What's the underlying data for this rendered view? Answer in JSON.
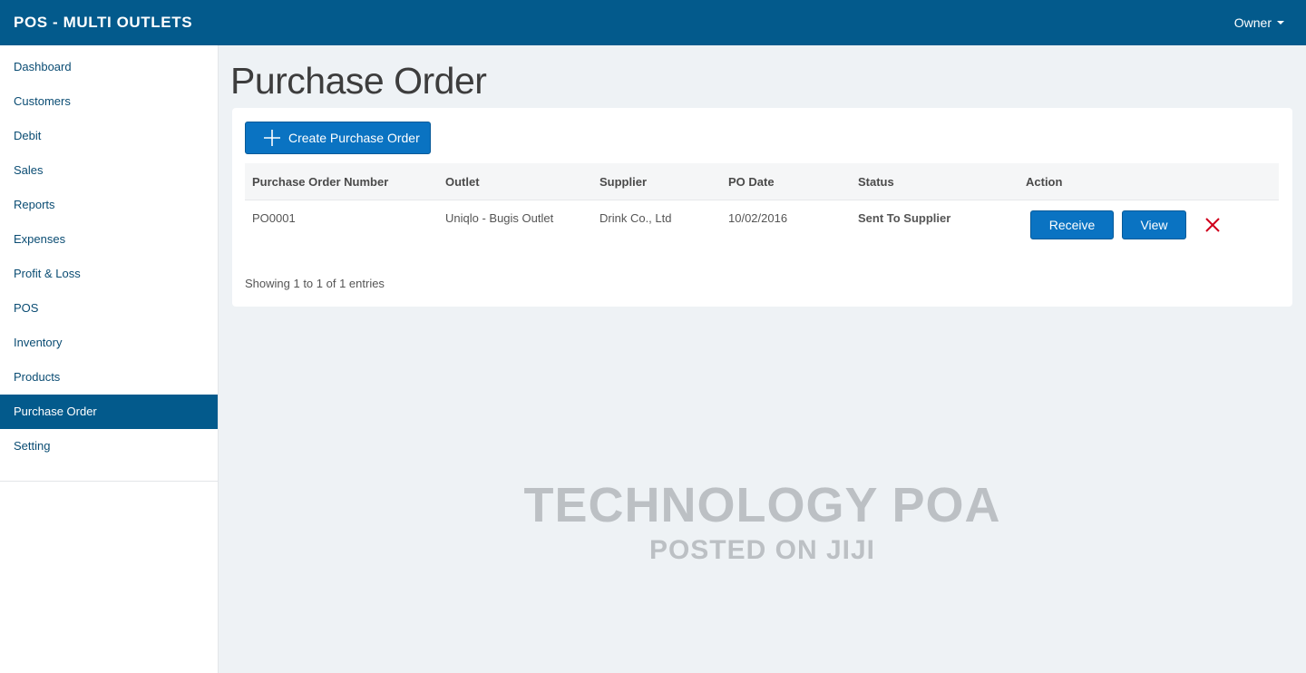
{
  "header": {
    "app_title": "POS - MULTI OUTLETS",
    "user_label": "Owner"
  },
  "sidebar": {
    "items": [
      {
        "label": "Dashboard"
      },
      {
        "label": "Customers"
      },
      {
        "label": "Debit"
      },
      {
        "label": "Sales"
      },
      {
        "label": "Reports"
      },
      {
        "label": "Expenses"
      },
      {
        "label": "Profit & Loss"
      },
      {
        "label": "POS"
      },
      {
        "label": "Inventory"
      },
      {
        "label": "Products"
      },
      {
        "label": "Purchase Order",
        "active": true
      },
      {
        "label": "Setting"
      }
    ]
  },
  "main": {
    "title": "Purchase Order",
    "create_label": "Create Purchase Order",
    "table": {
      "headers": [
        "Purchase Order Number",
        "Outlet",
        "Supplier",
        "PO Date",
        "Status",
        "Action"
      ],
      "rows": [
        {
          "po_number": "PO0001",
          "outlet": "Uniqlo - Bugis Outlet",
          "supplier": "Drink Co., Ltd",
          "po_date": "10/02/2016",
          "status": "Sent To Supplier",
          "receive_label": "Receive",
          "view_label": "View"
        }
      ]
    },
    "info": "Showing 1 to 1 of 1 entries"
  },
  "watermark": {
    "line1": "TECHNOLOGY POA",
    "line2": "POSTED ON JIJI"
  },
  "colors": {
    "brand": "#035a8c",
    "button": "#0a73c2",
    "delete": "#d0021b"
  },
  "icons": {
    "create": "plus-icon",
    "delete": "close-icon",
    "user_menu": "caret-down-icon"
  }
}
